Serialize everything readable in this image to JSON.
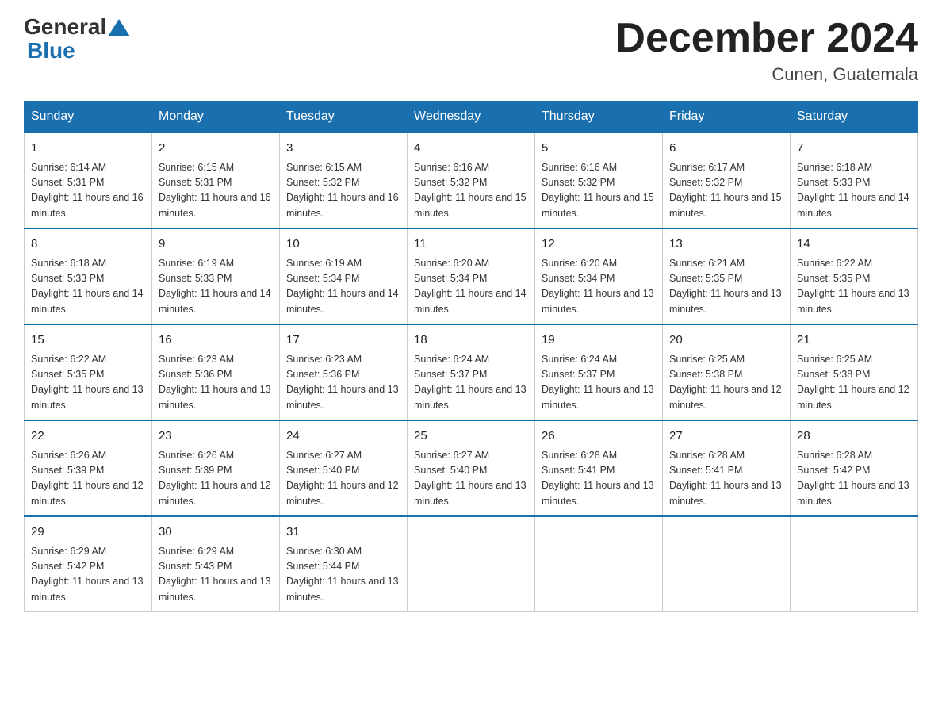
{
  "header": {
    "logo_general": "General",
    "logo_blue": "Blue",
    "month_title": "December 2024",
    "location": "Cunen, Guatemala"
  },
  "days_of_week": [
    "Sunday",
    "Monday",
    "Tuesday",
    "Wednesday",
    "Thursday",
    "Friday",
    "Saturday"
  ],
  "weeks": [
    [
      {
        "day": "1",
        "sunrise": "6:14 AM",
        "sunset": "5:31 PM",
        "daylight": "11 hours and 16 minutes."
      },
      {
        "day": "2",
        "sunrise": "6:15 AM",
        "sunset": "5:31 PM",
        "daylight": "11 hours and 16 minutes."
      },
      {
        "day": "3",
        "sunrise": "6:15 AM",
        "sunset": "5:32 PM",
        "daylight": "11 hours and 16 minutes."
      },
      {
        "day": "4",
        "sunrise": "6:16 AM",
        "sunset": "5:32 PM",
        "daylight": "11 hours and 15 minutes."
      },
      {
        "day": "5",
        "sunrise": "6:16 AM",
        "sunset": "5:32 PM",
        "daylight": "11 hours and 15 minutes."
      },
      {
        "day": "6",
        "sunrise": "6:17 AM",
        "sunset": "5:32 PM",
        "daylight": "11 hours and 15 minutes."
      },
      {
        "day": "7",
        "sunrise": "6:18 AM",
        "sunset": "5:33 PM",
        "daylight": "11 hours and 14 minutes."
      }
    ],
    [
      {
        "day": "8",
        "sunrise": "6:18 AM",
        "sunset": "5:33 PM",
        "daylight": "11 hours and 14 minutes."
      },
      {
        "day": "9",
        "sunrise": "6:19 AM",
        "sunset": "5:33 PM",
        "daylight": "11 hours and 14 minutes."
      },
      {
        "day": "10",
        "sunrise": "6:19 AM",
        "sunset": "5:34 PM",
        "daylight": "11 hours and 14 minutes."
      },
      {
        "day": "11",
        "sunrise": "6:20 AM",
        "sunset": "5:34 PM",
        "daylight": "11 hours and 14 minutes."
      },
      {
        "day": "12",
        "sunrise": "6:20 AM",
        "sunset": "5:34 PM",
        "daylight": "11 hours and 13 minutes."
      },
      {
        "day": "13",
        "sunrise": "6:21 AM",
        "sunset": "5:35 PM",
        "daylight": "11 hours and 13 minutes."
      },
      {
        "day": "14",
        "sunrise": "6:22 AM",
        "sunset": "5:35 PM",
        "daylight": "11 hours and 13 minutes."
      }
    ],
    [
      {
        "day": "15",
        "sunrise": "6:22 AM",
        "sunset": "5:35 PM",
        "daylight": "11 hours and 13 minutes."
      },
      {
        "day": "16",
        "sunrise": "6:23 AM",
        "sunset": "5:36 PM",
        "daylight": "11 hours and 13 minutes."
      },
      {
        "day": "17",
        "sunrise": "6:23 AM",
        "sunset": "5:36 PM",
        "daylight": "11 hours and 13 minutes."
      },
      {
        "day": "18",
        "sunrise": "6:24 AM",
        "sunset": "5:37 PM",
        "daylight": "11 hours and 13 minutes."
      },
      {
        "day": "19",
        "sunrise": "6:24 AM",
        "sunset": "5:37 PM",
        "daylight": "11 hours and 13 minutes."
      },
      {
        "day": "20",
        "sunrise": "6:25 AM",
        "sunset": "5:38 PM",
        "daylight": "11 hours and 12 minutes."
      },
      {
        "day": "21",
        "sunrise": "6:25 AM",
        "sunset": "5:38 PM",
        "daylight": "11 hours and 12 minutes."
      }
    ],
    [
      {
        "day": "22",
        "sunrise": "6:26 AM",
        "sunset": "5:39 PM",
        "daylight": "11 hours and 12 minutes."
      },
      {
        "day": "23",
        "sunrise": "6:26 AM",
        "sunset": "5:39 PM",
        "daylight": "11 hours and 12 minutes."
      },
      {
        "day": "24",
        "sunrise": "6:27 AM",
        "sunset": "5:40 PM",
        "daylight": "11 hours and 12 minutes."
      },
      {
        "day": "25",
        "sunrise": "6:27 AM",
        "sunset": "5:40 PM",
        "daylight": "11 hours and 13 minutes."
      },
      {
        "day": "26",
        "sunrise": "6:28 AM",
        "sunset": "5:41 PM",
        "daylight": "11 hours and 13 minutes."
      },
      {
        "day": "27",
        "sunrise": "6:28 AM",
        "sunset": "5:41 PM",
        "daylight": "11 hours and 13 minutes."
      },
      {
        "day": "28",
        "sunrise": "6:28 AM",
        "sunset": "5:42 PM",
        "daylight": "11 hours and 13 minutes."
      }
    ],
    [
      {
        "day": "29",
        "sunrise": "6:29 AM",
        "sunset": "5:42 PM",
        "daylight": "11 hours and 13 minutes."
      },
      {
        "day": "30",
        "sunrise": "6:29 AM",
        "sunset": "5:43 PM",
        "daylight": "11 hours and 13 minutes."
      },
      {
        "day": "31",
        "sunrise": "6:30 AM",
        "sunset": "5:44 PM",
        "daylight": "11 hours and 13 minutes."
      },
      null,
      null,
      null,
      null
    ]
  ]
}
